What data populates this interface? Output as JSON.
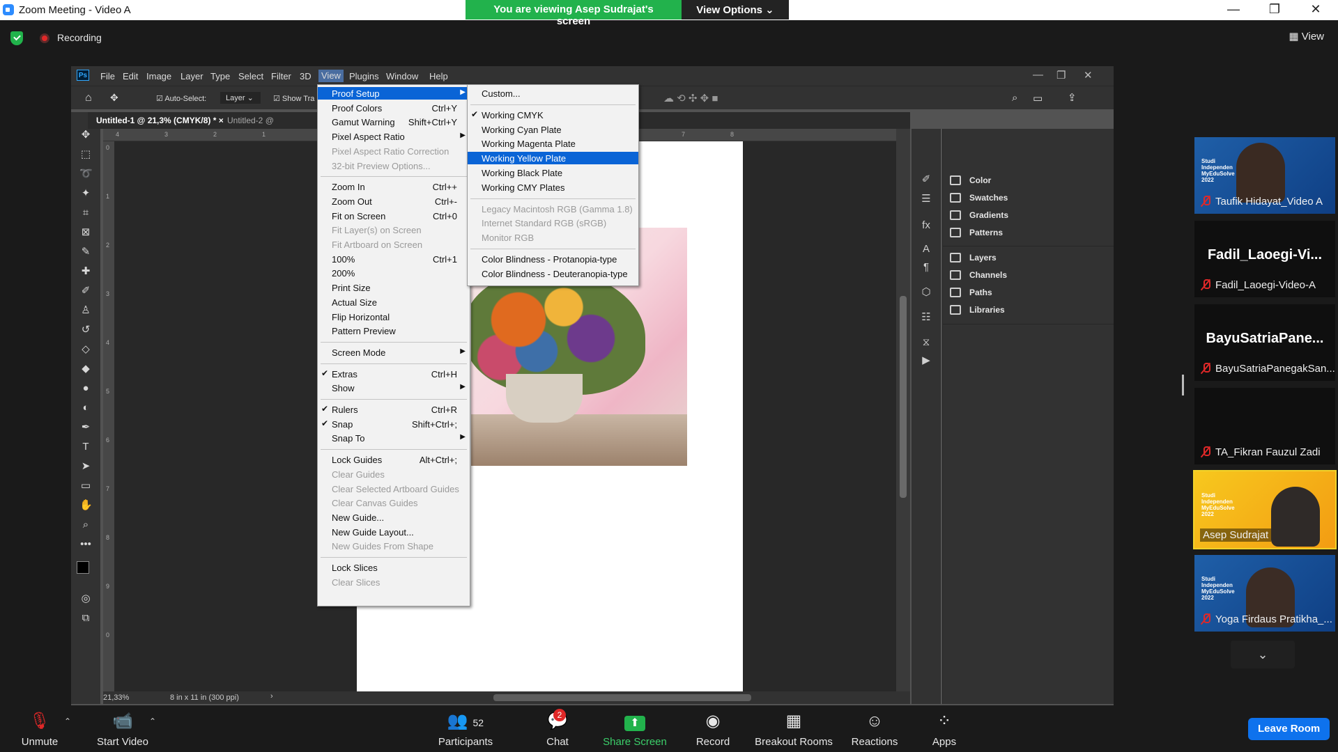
{
  "window": {
    "title": "Zoom Meeting - Video A",
    "share_banner": "You are viewing Asep Sudrajat's screen",
    "view_options": "View Options",
    "minimize": "—",
    "restore": "❐",
    "close": "✕"
  },
  "recording": {
    "label": "Recording",
    "view_label": "View"
  },
  "photoshop": {
    "menu": [
      "File",
      "Edit",
      "Image",
      "Layer",
      "Type",
      "Select",
      "Filter",
      "3D",
      "View",
      "Plugins",
      "Window",
      "Help"
    ],
    "active_menu": "View",
    "options": {
      "auto_select": "Auto-Select:",
      "layer": "Layer",
      "show_transform": "Show Tra"
    },
    "tabs": [
      "Untitled-1 @ 21,3% (CMYK/8) *",
      "Untitled-2 @"
    ],
    "ruler_h": [
      "4",
      "3",
      "2",
      "1",
      "7",
      "8"
    ],
    "ruler_v": [
      "0",
      "1",
      "2",
      "3",
      "4",
      "5",
      "6",
      "7",
      "8",
      "9",
      "0"
    ],
    "status": {
      "zoom": "21,33%",
      "doc_info": "8 in x 11 in (300 ppi)"
    },
    "panels": [
      "Color",
      "Swatches",
      "Gradients",
      "Patterns",
      "Layers",
      "Channels",
      "Paths",
      "Libraries"
    ]
  },
  "view_menu": {
    "items": [
      {
        "label": "Proof Setup",
        "shortcut": "",
        "submenu": true,
        "highlight": true
      },
      {
        "label": "Proof Colors",
        "shortcut": "Ctrl+Y"
      },
      {
        "label": "Gamut Warning",
        "shortcut": "Shift+Ctrl+Y"
      },
      {
        "label": "Pixel Aspect Ratio",
        "shortcut": "",
        "submenu": true
      },
      {
        "label": "Pixel Aspect Ratio Correction",
        "shortcut": "",
        "disabled": true
      },
      {
        "label": "32-bit Preview Options...",
        "shortcut": "",
        "disabled": true
      },
      {
        "label": "Zoom In",
        "shortcut": "Ctrl++"
      },
      {
        "label": "Zoom Out",
        "shortcut": "Ctrl+-"
      },
      {
        "label": "Fit on Screen",
        "shortcut": "Ctrl+0"
      },
      {
        "label": "Fit Layer(s) on Screen",
        "shortcut": "",
        "disabled": true
      },
      {
        "label": "Fit Artboard on Screen",
        "shortcut": "",
        "disabled": true
      },
      {
        "label": "100%",
        "shortcut": "Ctrl+1"
      },
      {
        "label": "200%",
        "shortcut": ""
      },
      {
        "label": "Print Size",
        "shortcut": ""
      },
      {
        "label": "Actual Size",
        "shortcut": ""
      },
      {
        "label": "Flip Horizontal",
        "shortcut": ""
      },
      {
        "label": "Pattern Preview",
        "shortcut": ""
      },
      {
        "label": "Screen Mode",
        "shortcut": "",
        "submenu": true
      },
      {
        "label": "Extras",
        "shortcut": "Ctrl+H",
        "checked": true
      },
      {
        "label": "Show",
        "shortcut": "",
        "submenu": true
      },
      {
        "label": "Rulers",
        "shortcut": "Ctrl+R",
        "checked": true
      },
      {
        "label": "Snap",
        "shortcut": "Shift+Ctrl+;",
        "checked": true
      },
      {
        "label": "Snap To",
        "shortcut": "",
        "submenu": true
      },
      {
        "label": "Lock Guides",
        "shortcut": "Alt+Ctrl+;"
      },
      {
        "label": "Clear Guides",
        "shortcut": "",
        "disabled": true
      },
      {
        "label": "Clear Selected Artboard Guides",
        "shortcut": "",
        "disabled": true
      },
      {
        "label": "Clear Canvas Guides",
        "shortcut": "",
        "disabled": true
      },
      {
        "label": "New Guide...",
        "shortcut": ""
      },
      {
        "label": "New Guide Layout...",
        "shortcut": ""
      },
      {
        "label": "New Guides From Shape",
        "shortcut": "",
        "disabled": true
      },
      {
        "label": "Lock Slices",
        "shortcut": ""
      },
      {
        "label": "Clear Slices",
        "shortcut": "",
        "disabled": true
      }
    ]
  },
  "proof_menu": {
    "items": [
      {
        "label": "Custom..."
      },
      {
        "label": "Working CMYK",
        "checked": true
      },
      {
        "label": "Working Cyan Plate"
      },
      {
        "label": "Working Magenta Plate"
      },
      {
        "label": "Working Yellow Plate",
        "highlight": true
      },
      {
        "label": "Working Black Plate"
      },
      {
        "label": "Working CMY Plates"
      },
      {
        "label": "Legacy Macintosh RGB (Gamma 1.8)",
        "disabled": true
      },
      {
        "label": "Internet Standard RGB (sRGB)",
        "disabled": true
      },
      {
        "label": "Monitor RGB",
        "disabled": true
      },
      {
        "label": "Color Blindness - Protanopia-type"
      },
      {
        "label": "Color Blindness - Deuteranopia-type"
      }
    ]
  },
  "participants": {
    "tiles": [
      {
        "name": "Taufik Hidayat_Video A",
        "muted": true,
        "video": true
      },
      {
        "name": "Fadil_Laoegi-Video-A",
        "display": "Fadil_Laoegi-Vi...",
        "muted": true
      },
      {
        "name": "BayuSatriaPanegakSan...",
        "display": "BayuSatriaPane...",
        "muted": true
      },
      {
        "name": "TA_Fikran Fauzul Zadi",
        "muted": true
      },
      {
        "name": "Asep Sudrajat",
        "muted": false,
        "video": true,
        "speaking": true
      },
      {
        "name": "Yoga Firdaus Pratikha_...",
        "muted": true,
        "video": true
      }
    ],
    "edu_text": "Studi Independen MyEduSolve 2022"
  },
  "controls": {
    "unmute": "Unmute",
    "start_video": "Start Video",
    "participants": "Participants",
    "participants_count": "52",
    "chat": "Chat",
    "chat_badge": "2",
    "share_screen": "Share Screen",
    "record": "Record",
    "breakout_rooms": "Breakout Rooms",
    "reactions": "Reactions",
    "apps": "Apps",
    "leave_room": "Leave Room"
  }
}
